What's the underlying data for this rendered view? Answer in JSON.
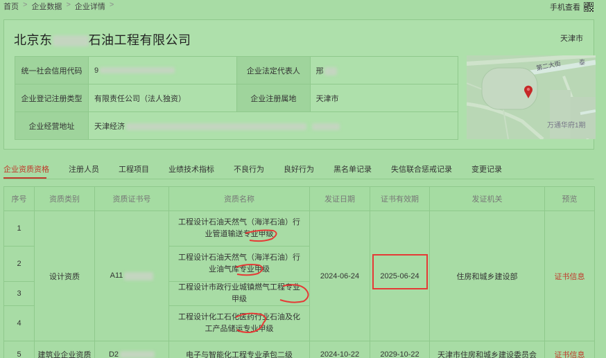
{
  "breadcrumb": [
    "首页",
    "企业数据",
    "企业详情"
  ],
  "mobile_view": "手机查看",
  "company": {
    "name_prefix": "北京东",
    "name_suffix": "石油工程有限公司",
    "city": "天津市"
  },
  "info": {
    "credit_code_label": "统一社会信用代码",
    "credit_code_value": "9",
    "legal_rep_label": "企业法定代表人",
    "legal_rep_value": "邢",
    "reg_type_label": "企业登记注册类型",
    "reg_type_value": "有限责任公司（法人独资）",
    "reg_place_label": "企业注册属地",
    "reg_place_value": "天津市",
    "address_label": "企业经营地址",
    "address_value": "天津经济"
  },
  "map": {
    "road_label": "第二大街",
    "poi_label": "万通华府1期",
    "poi_label2": "泰"
  },
  "tabs": [
    "企业资质资格",
    "注册人员",
    "工程项目",
    "业绩技术指标",
    "不良行为",
    "良好行为",
    "黑名单记录",
    "失信联合惩戒记录",
    "变更记录"
  ],
  "table": {
    "headers": [
      "序号",
      "资质类别",
      "资质证书号",
      "资质名称",
      "发证日期",
      "证书有效期",
      "发证机关",
      "预览"
    ],
    "group1": {
      "category": "设计资质",
      "cert_no": "A11",
      "issue_date": "2024-06-24",
      "expiry": "2025-06-24",
      "authority": "住房和城乡建设部",
      "preview": "证书信息",
      "rows": [
        {
          "no": "1",
          "name": "工程设计石油天然气（海洋石油）行业管道输送专业甲级"
        },
        {
          "no": "2",
          "name": "工程设计石油天然气（海洋石油）行业油气库专业甲级"
        },
        {
          "no": "3",
          "name": "工程设计市政行业城镇燃气工程专业甲级"
        },
        {
          "no": "4",
          "name": "工程设计化工石化医药行业石油及化工产品储运专业甲级"
        }
      ]
    },
    "row5": {
      "no": "5",
      "category": "建筑业企业资质",
      "cert_no": "D2",
      "name": "电子与智能化工程专业承包二级",
      "issue_date": "2024-10-22",
      "expiry": "2029-10-22",
      "authority": "天津市住房和城乡建设委员会",
      "preview": "证书信息"
    }
  },
  "colors": {
    "background": "#a8dca5",
    "accent": "#c0392b",
    "border": "#8fc98c"
  }
}
